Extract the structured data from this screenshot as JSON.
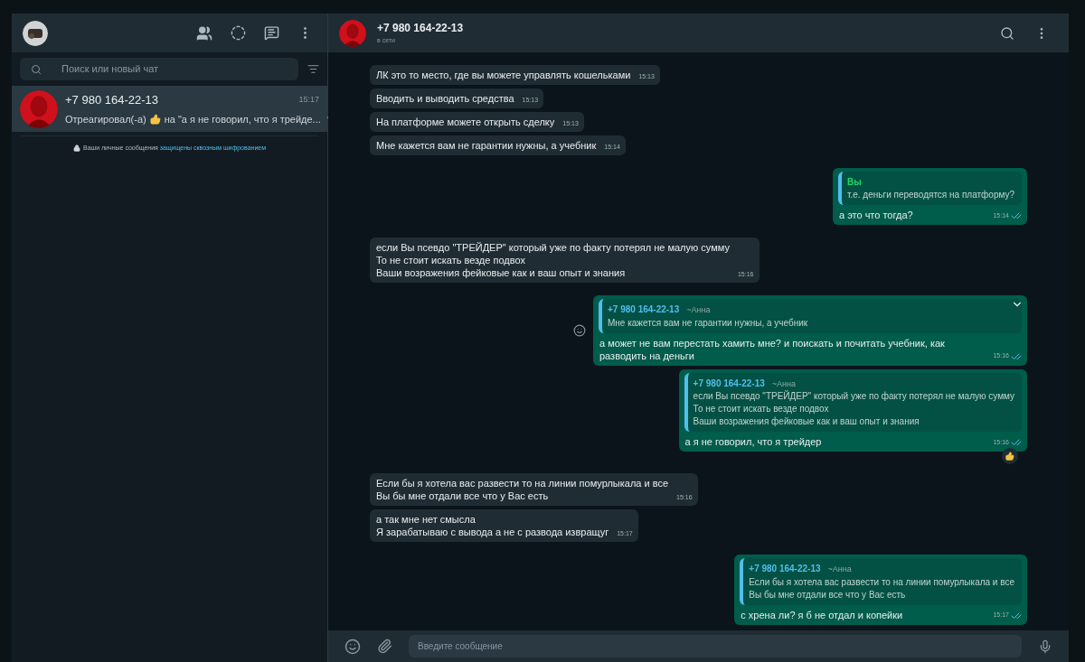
{
  "sidebar": {
    "search": {
      "placeholder": "Поиск или новый чат"
    },
    "chats": [
      {
        "name": "+7 980 164-22-13",
        "time": "15:17",
        "preview_prefix": "Отреагировал(-а)",
        "preview_reacted": true,
        "preview_suffix": "на \"а я не говорил, что я трейде...",
        "selected": true
      }
    ],
    "encryption": {
      "text": "Ваши личные сообщения",
      "link": "защищены сквозным шифрованием"
    }
  },
  "chat": {
    "name": "+7 980 164-22-13",
    "status": "в сети",
    "messages": [
      {
        "kind": "incoming",
        "text": "ЛК это то место, где вы можете управлять кошельками",
        "time": "15:13"
      },
      {
        "kind": "incoming",
        "text": "Вводить и выводить средства",
        "time": "15:13"
      },
      {
        "kind": "incoming",
        "text": "На платформе можете открыть сделку",
        "time": "15:13"
      },
      {
        "kind": "incoming",
        "text": "Мне кажется вам не гарантии нужны, а учебник",
        "time": "15:14"
      },
      {
        "kind": "outgoing",
        "quote": {
          "author": "Вы",
          "from_self": true,
          "text": "т.е. деньги переводятся на платформу?"
        },
        "text": "а это что тогда?",
        "time": "15:14",
        "read": true
      },
      {
        "kind": "incoming",
        "text": "если Вы псевдо \"ТРЕЙДЕР\" который уже по факту потерял не малую сумму\nТо не стоит искать везде подвох\nВаши возражения фейковые как и ваш опыт и знания",
        "time": "15:16"
      },
      {
        "kind": "outgoing",
        "hovered": true,
        "quote": {
          "author": "+7 980 164-22-13",
          "note": "~Анна",
          "from_self": false,
          "text": "Мне кажется вам не гарантии нужны, а учебник"
        },
        "text": "а может не вам перестать хамить мне? и поискать и почитать учебник, как разводить на деньги",
        "time": "15:16",
        "read": true
      },
      {
        "kind": "outgoing",
        "reacted": true,
        "quote": {
          "author": "+7 980 164-22-13",
          "note": "~Анна",
          "from_self": false,
          "text": "если Вы псевдо \"ТРЕЙДЕР\" который уже по факту потерял не малую сумму\nТо не стоит искать везде подвох\nВаши возражения фейковые как и ваш опыт и знания"
        },
        "text": "а я не говорил, что я трейдер",
        "time": "15:16",
        "read": true
      },
      {
        "kind": "incoming",
        "text": "Если бы я хотела вас развести то на линии помурлыкала и все\nВы бы мне отдали все что у Вас есть",
        "time": "15:16"
      },
      {
        "kind": "incoming",
        "text": "а так мне нет смысла\nЯ зарабатываю с вывода а не с развода извращуг",
        "time": "15:17"
      },
      {
        "kind": "outgoing",
        "quote": {
          "author": "+7 980 164-22-13",
          "note": "~Анна",
          "from_self": false,
          "text": "Если бы я хотела вас развести то на линии помурлыкала и все\nВы бы мне отдали все что у Вас есть"
        },
        "text": "с хрена ли? я б не отдал и копейки",
        "time": "15:17",
        "read": true
      }
    ]
  },
  "composer": {
    "placeholder": "Введите сообщение"
  }
}
